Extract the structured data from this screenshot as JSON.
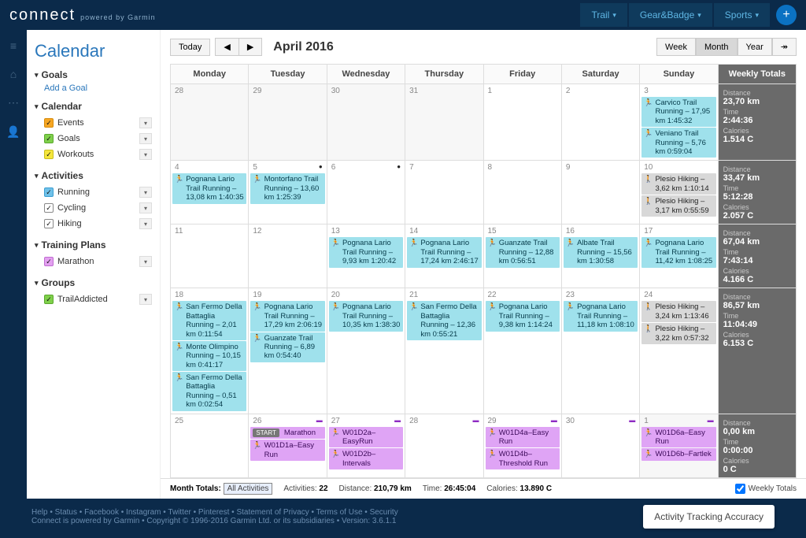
{
  "brand": {
    "name": "connect",
    "tagline": "powered by Garmin"
  },
  "topnav": [
    {
      "label": "Trail"
    },
    {
      "label": "Gear&Badge"
    },
    {
      "label": "Sports"
    }
  ],
  "page_title": "Calendar",
  "sidebar": {
    "goals": {
      "heading": "Goals",
      "add": "Add a Goal"
    },
    "calendar": {
      "heading": "Calendar",
      "items": [
        {
          "label": "Events",
          "color": "orange"
        },
        {
          "label": "Goals",
          "color": "green"
        },
        {
          "label": "Workouts",
          "color": "yellow"
        }
      ]
    },
    "activities": {
      "heading": "Activities",
      "items": [
        {
          "label": "Running",
          "color": "blue"
        },
        {
          "label": "Cycling",
          "color": "white"
        },
        {
          "label": "Hiking",
          "color": "white"
        }
      ]
    },
    "training": {
      "heading": "Training Plans",
      "items": [
        {
          "label": "Marathon",
          "color": "pink"
        }
      ]
    },
    "groups": {
      "heading": "Groups",
      "items": [
        {
          "label": "TrailAddicted",
          "color": "green"
        }
      ]
    }
  },
  "toolbar": {
    "today": "Today",
    "title": "April 2016",
    "views": {
      "week": "Week",
      "month": "Month",
      "year": "Year"
    }
  },
  "dow": [
    "Monday",
    "Tuesday",
    "Wednesday",
    "Thursday",
    "Friday",
    "Saturday",
    "Sunday"
  ],
  "weekly_header": "Weekly Totals",
  "weeks": [
    {
      "days": [
        {
          "n": "28",
          "out": true,
          "events": []
        },
        {
          "n": "29",
          "out": true,
          "events": []
        },
        {
          "n": "30",
          "out": true,
          "events": []
        },
        {
          "n": "31",
          "out": true,
          "events": []
        },
        {
          "n": "1",
          "events": []
        },
        {
          "n": "2",
          "events": []
        },
        {
          "n": "3",
          "events": [
            {
              "type": "run",
              "ico": "🏃",
              "text": "Carvico Trail Running – 17,95 km 1:45:32"
            },
            {
              "type": "run",
              "ico": "🏃",
              "text": "Veniano Trail Running – 5,76 km 0:59:04"
            }
          ]
        }
      ],
      "totals": {
        "distance": "23,70 km",
        "time": "2:44:36",
        "calories": "1.514 C"
      }
    },
    {
      "days": [
        {
          "n": "4",
          "events": [
            {
              "type": "run",
              "ico": "🏃",
              "text": "Pognana Lario Trail Running – 13,08 km 1:40:35"
            }
          ]
        },
        {
          "n": "5",
          "badge": true,
          "events": [
            {
              "type": "run",
              "ico": "🏃",
              "text": "Montorfano Trail Running – 13,60 km 1:25:39"
            }
          ]
        },
        {
          "n": "6",
          "badge": true,
          "events": []
        },
        {
          "n": "7",
          "events": []
        },
        {
          "n": "8",
          "events": []
        },
        {
          "n": "9",
          "events": []
        },
        {
          "n": "10",
          "events": [
            {
              "type": "hike",
              "ico": "🚶",
              "text": "Plesio Hiking – 3,62 km 1:10:14"
            },
            {
              "type": "hike",
              "ico": "🚶",
              "text": "Plesio Hiking – 3,17 km 0:55:59"
            }
          ]
        }
      ],
      "totals": {
        "distance": "33,47 km",
        "time": "5:12:28",
        "calories": "2.057 C"
      }
    },
    {
      "days": [
        {
          "n": "11",
          "events": []
        },
        {
          "n": "12",
          "events": []
        },
        {
          "n": "13",
          "events": [
            {
              "type": "run",
              "ico": "🏃",
              "text": "Pognana Lario Trail Running – 9,93 km 1:20:42"
            }
          ]
        },
        {
          "n": "14",
          "events": [
            {
              "type": "run",
              "ico": "🏃",
              "text": "Pognana Lario Trail Running – 17,24 km 2:46:17"
            }
          ]
        },
        {
          "n": "15",
          "events": [
            {
              "type": "run",
              "ico": "🏃",
              "text": "Guanzate Trail Running – 12,88 km 0:56:51"
            }
          ]
        },
        {
          "n": "16",
          "events": [
            {
              "type": "run",
              "ico": "🏃",
              "text": "Albate Trail Running – 15,56 km 1:30:58"
            }
          ]
        },
        {
          "n": "17",
          "events": [
            {
              "type": "run",
              "ico": "🏃",
              "text": "Pognana Lario Trail Running – 11,42 km 1:08:25"
            }
          ]
        }
      ],
      "totals": {
        "distance": "67,04 km",
        "time": "7:43:14",
        "calories": "4.166 C"
      }
    },
    {
      "days": [
        {
          "n": "18",
          "events": [
            {
              "type": "run",
              "ico": "🏃",
              "text": "San Fermo Della Battaglia Running – 2,01 km 0:11:54"
            },
            {
              "type": "run",
              "ico": "🏃",
              "text": "Monte Olimpino Running – 10,15 km 0:41:17"
            },
            {
              "type": "run",
              "ico": "🏃",
              "text": "San Fermo Della Battaglia Running – 0,51 km 0:02:54"
            }
          ]
        },
        {
          "n": "19",
          "events": [
            {
              "type": "run",
              "ico": "🏃",
              "text": "Pognana Lario Trail Running – 17,29 km 2:06:19"
            },
            {
              "type": "run",
              "ico": "🏃",
              "text": "Guanzate Trail Running – 6,89 km 0:54:40"
            }
          ]
        },
        {
          "n": "20",
          "events": [
            {
              "type": "run",
              "ico": "🏃",
              "text": "Pognana Lario Trail Running – 10,35 km 1:38:30"
            }
          ]
        },
        {
          "n": "21",
          "events": [
            {
              "type": "run",
              "ico": "🏃",
              "text": "San Fermo Della Battaglia Running – 12,36 km 0:55:21"
            }
          ]
        },
        {
          "n": "22",
          "events": [
            {
              "type": "run",
              "ico": "🏃",
              "text": "Pognana Lario Trail Running – 9,38 km 1:14:24"
            }
          ]
        },
        {
          "n": "23",
          "events": [
            {
              "type": "run",
              "ico": "🏃",
              "text": "Pognana Lario Trail Running – 11,18 km 1:08:10"
            }
          ]
        },
        {
          "n": "24",
          "events": [
            {
              "type": "hike",
              "ico": "🚶",
              "text": "Plesio Hiking – 3,24 km 1:13:46"
            },
            {
              "type": "hike",
              "ico": "🚶",
              "text": "Plesio Hiking – 3,22 km 0:57:32"
            }
          ]
        }
      ],
      "totals": {
        "distance": "86,57 km",
        "time": "11:04:49",
        "calories": "6.153 C"
      }
    },
    {
      "days": [
        {
          "n": "25",
          "events": []
        },
        {
          "n": "26",
          "planmark": true,
          "events": [
            {
              "type": "plan",
              "start": true,
              "text": "Marathon"
            },
            {
              "type": "plan",
              "ico": "🏃",
              "text": "W01D1a–Easy Run"
            }
          ]
        },
        {
          "n": "27",
          "planmark": true,
          "events": [
            {
              "type": "plan",
              "ico": "🏃",
              "text": "W01D2a–EasyRun"
            },
            {
              "type": "plan",
              "ico": "🏃",
              "text": "W01D2b–Intervals"
            }
          ]
        },
        {
          "n": "28",
          "planmark": true,
          "events": []
        },
        {
          "n": "29",
          "planmark": true,
          "events": [
            {
              "type": "plan",
              "ico": "🏃",
              "text": "W01D4a–Easy Run"
            },
            {
              "type": "plan",
              "ico": "🏃",
              "text": "W01D4b–Threshold Run"
            }
          ]
        },
        {
          "n": "30",
          "planmark": true,
          "events": []
        },
        {
          "n": "1",
          "out": true,
          "planmark": true,
          "events": [
            {
              "type": "plan",
              "ico": "🏃",
              "text": "W01D6a–Easy Run"
            },
            {
              "type": "plan",
              "ico": "🏃",
              "text": "W01D6b–Fartlek"
            }
          ]
        }
      ],
      "totals": {
        "distance": "0,00 km",
        "time": "0:00:00",
        "calories": "0 C"
      }
    }
  ],
  "totals_labels": {
    "distance": "Distance",
    "time": "Time",
    "calories": "Calories"
  },
  "month_totals": {
    "label": "Month Totals:",
    "filter": "All Activities",
    "activities_label": "Activities:",
    "activities": "22",
    "distance_label": "Distance:",
    "distance": "210,79 km",
    "time_label": "Time:",
    "time": "26:45:04",
    "calories_label": "Calories:",
    "calories": "13.890 C",
    "weekly_chk": "Weekly Totals"
  },
  "footer": {
    "links": [
      "Help",
      "Status",
      "Facebook",
      "Instagram",
      "Twitter",
      "Pinterest",
      "Statement of Privacy",
      "Terms of Use",
      "Security"
    ],
    "copyright": "Connect is powered by Garmin • Copyright © 1996-2016 Garmin Ltd. or its subsidiaries • Version: 3.6.1.1",
    "tracking": "Activity Tracking Accuracy"
  },
  "start_label": "START"
}
